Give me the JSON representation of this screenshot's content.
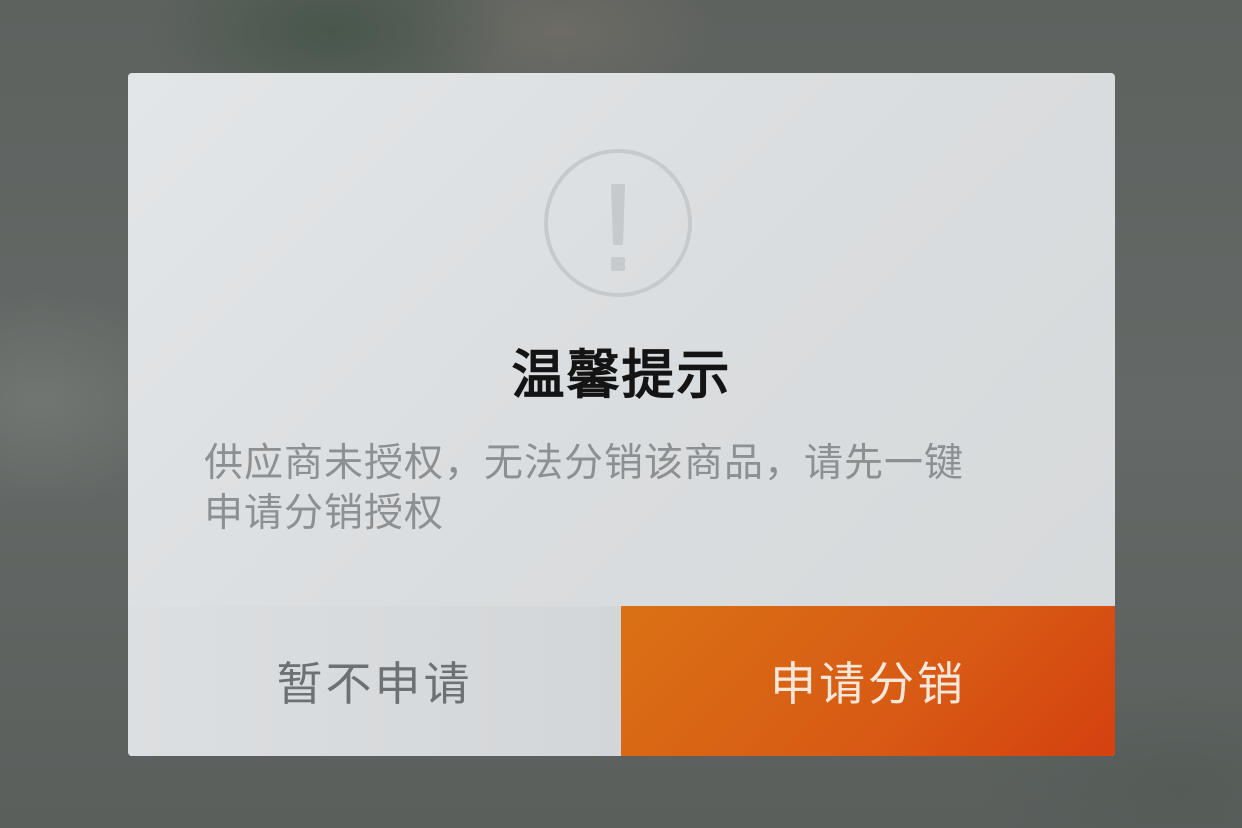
{
  "dialog": {
    "icon": "exclamation-circle-icon",
    "title": "温馨提示",
    "message_line1": "供应商未授权，无法分销该商品，请先一键",
    "message_line2": "申请分销授权",
    "cancel_label": "暂不申请",
    "confirm_label": "申请分销"
  },
  "colors": {
    "dialog_background": "#dcdfe1",
    "title_text": "#141414",
    "message_text": "#8d9092",
    "cancel_background": "#d6d9db",
    "cancel_text": "#6e7173",
    "confirm_background": "#d85a14",
    "confirm_text": "#f7e7db",
    "icon": "#c7cacc"
  }
}
